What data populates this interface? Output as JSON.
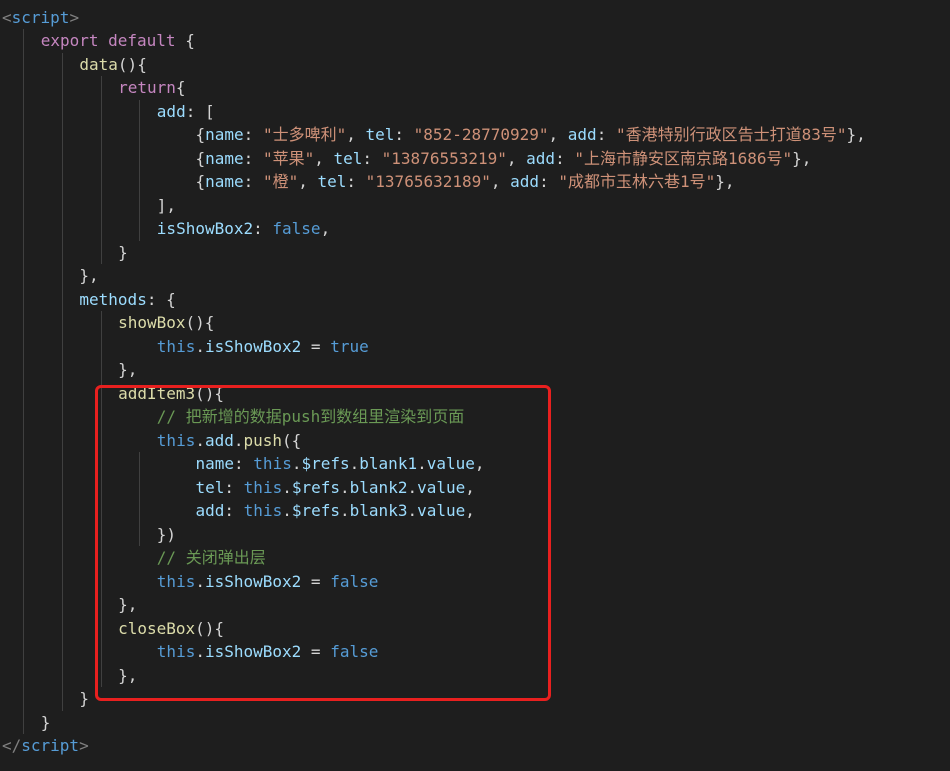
{
  "theme": {
    "background": "#1e1e1e",
    "highlight_box_color": "#e8201f"
  },
  "code_lines": [
    {
      "tokens": [
        {
          "c": "tag",
          "t": "<"
        },
        {
          "c": "tn",
          "t": "script"
        },
        {
          "c": "tag",
          "t": ">"
        }
      ]
    },
    {
      "tokens": [
        {
          "c": "kp",
          "t": "export"
        },
        {
          "c": "t",
          "t": " "
        },
        {
          "c": "kp",
          "t": "default"
        },
        {
          "c": "t",
          "t": " {"
        }
      ]
    },
    {
      "tokens": [
        {
          "c": "f",
          "t": "data"
        },
        {
          "c": "t",
          "t": "(){"
        }
      ]
    },
    {
      "tokens": [
        {
          "c": "kp",
          "t": "return"
        },
        {
          "c": "t",
          "t": "{"
        }
      ]
    },
    {
      "tokens": [
        {
          "c": "p",
          "t": "add"
        },
        {
          "c": "t",
          "t": ": ["
        }
      ]
    },
    {
      "tokens": [
        {
          "c": "t",
          "t": "{"
        },
        {
          "c": "p",
          "t": "name"
        },
        {
          "c": "t",
          "t": ": "
        },
        {
          "c": "s",
          "t": "\"士多啤利\""
        },
        {
          "c": "t",
          "t": ", "
        },
        {
          "c": "p",
          "t": "tel"
        },
        {
          "c": "t",
          "t": ": "
        },
        {
          "c": "s",
          "t": "\"852-28770929\""
        },
        {
          "c": "t",
          "t": ", "
        },
        {
          "c": "p",
          "t": "add"
        },
        {
          "c": "t",
          "t": ": "
        },
        {
          "c": "s",
          "t": "\"香港特别行政区告士打道83号\""
        },
        {
          "c": "t",
          "t": "},"
        }
      ]
    },
    {
      "tokens": [
        {
          "c": "t",
          "t": "{"
        },
        {
          "c": "p",
          "t": "name"
        },
        {
          "c": "t",
          "t": ": "
        },
        {
          "c": "s",
          "t": "\"苹果\""
        },
        {
          "c": "t",
          "t": ", "
        },
        {
          "c": "p",
          "t": "tel"
        },
        {
          "c": "t",
          "t": ": "
        },
        {
          "c": "s",
          "t": "\"13876553219\""
        },
        {
          "c": "t",
          "t": ", "
        },
        {
          "c": "p",
          "t": "add"
        },
        {
          "c": "t",
          "t": ": "
        },
        {
          "c": "s",
          "t": "\"上海市静安区南京路1686号\""
        },
        {
          "c": "t",
          "t": "},"
        }
      ]
    },
    {
      "tokens": [
        {
          "c": "t",
          "t": "{"
        },
        {
          "c": "p",
          "t": "name"
        },
        {
          "c": "t",
          "t": ": "
        },
        {
          "c": "s",
          "t": "\"橙\""
        },
        {
          "c": "t",
          "t": ", "
        },
        {
          "c": "p",
          "t": "tel"
        },
        {
          "c": "t",
          "t": ": "
        },
        {
          "c": "s",
          "t": "\"13765632189\""
        },
        {
          "c": "t",
          "t": ", "
        },
        {
          "c": "p",
          "t": "add"
        },
        {
          "c": "t",
          "t": ": "
        },
        {
          "c": "s",
          "t": "\"成都市玉林六巷1号\""
        },
        {
          "c": "t",
          "t": "},"
        }
      ]
    },
    {
      "tokens": [
        {
          "c": "t",
          "t": "],"
        }
      ]
    },
    {
      "tokens": [
        {
          "c": "p",
          "t": "isShowBox2"
        },
        {
          "c": "t",
          "t": ": "
        },
        {
          "c": "k",
          "t": "false"
        },
        {
          "c": "t",
          "t": ","
        }
      ]
    },
    {
      "tokens": [
        {
          "c": "t",
          "t": "}"
        }
      ]
    },
    {
      "tokens": [
        {
          "c": "t",
          "t": "},"
        }
      ]
    },
    {
      "tokens": [
        {
          "c": "p",
          "t": "methods"
        },
        {
          "c": "t",
          "t": ": {"
        }
      ]
    },
    {
      "tokens": [
        {
          "c": "f",
          "t": "showBox"
        },
        {
          "c": "t",
          "t": "(){"
        }
      ]
    },
    {
      "tokens": [
        {
          "c": "k",
          "t": "this"
        },
        {
          "c": "t",
          "t": "."
        },
        {
          "c": "p",
          "t": "isShowBox2"
        },
        {
          "c": "t",
          "t": " = "
        },
        {
          "c": "k",
          "t": "true"
        }
      ]
    },
    {
      "tokens": [
        {
          "c": "t",
          "t": "},"
        }
      ]
    },
    {
      "tokens": [
        {
          "c": "f",
          "t": "addItem3"
        },
        {
          "c": "t",
          "t": "(){"
        }
      ]
    },
    {
      "tokens": [
        {
          "c": "c",
          "t": "// 把新增的数据push到数组里渲染到页面"
        }
      ]
    },
    {
      "tokens": [
        {
          "c": "k",
          "t": "this"
        },
        {
          "c": "t",
          "t": "."
        },
        {
          "c": "p",
          "t": "add"
        },
        {
          "c": "t",
          "t": "."
        },
        {
          "c": "f",
          "t": "push"
        },
        {
          "c": "t",
          "t": "({"
        }
      ]
    },
    {
      "tokens": [
        {
          "c": "p",
          "t": "name"
        },
        {
          "c": "t",
          "t": ": "
        },
        {
          "c": "k",
          "t": "this"
        },
        {
          "c": "t",
          "t": "."
        },
        {
          "c": "p",
          "t": "$refs"
        },
        {
          "c": "t",
          "t": "."
        },
        {
          "c": "p",
          "t": "blank1"
        },
        {
          "c": "t",
          "t": "."
        },
        {
          "c": "p",
          "t": "value"
        },
        {
          "c": "t",
          "t": ","
        }
      ]
    },
    {
      "tokens": [
        {
          "c": "p",
          "t": "tel"
        },
        {
          "c": "t",
          "t": ": "
        },
        {
          "c": "k",
          "t": "this"
        },
        {
          "c": "t",
          "t": "."
        },
        {
          "c": "p",
          "t": "$refs"
        },
        {
          "c": "t",
          "t": "."
        },
        {
          "c": "p",
          "t": "blank2"
        },
        {
          "c": "t",
          "t": "."
        },
        {
          "c": "p",
          "t": "value"
        },
        {
          "c": "t",
          "t": ","
        }
      ]
    },
    {
      "tokens": [
        {
          "c": "p",
          "t": "add"
        },
        {
          "c": "t",
          "t": ": "
        },
        {
          "c": "k",
          "t": "this"
        },
        {
          "c": "t",
          "t": "."
        },
        {
          "c": "p",
          "t": "$refs"
        },
        {
          "c": "t",
          "t": "."
        },
        {
          "c": "p",
          "t": "blank3"
        },
        {
          "c": "t",
          "t": "."
        },
        {
          "c": "p",
          "t": "value"
        },
        {
          "c": "t",
          "t": ","
        }
      ]
    },
    {
      "tokens": [
        {
          "c": "t",
          "t": "})"
        }
      ]
    },
    {
      "tokens": [
        {
          "c": "c",
          "t": "// 关闭弹出层"
        }
      ]
    },
    {
      "tokens": [
        {
          "c": "k",
          "t": "this"
        },
        {
          "c": "t",
          "t": "."
        },
        {
          "c": "p",
          "t": "isShowBox2"
        },
        {
          "c": "t",
          "t": " = "
        },
        {
          "c": "k",
          "t": "false"
        }
      ]
    },
    {
      "tokens": [
        {
          "c": "t",
          "t": "},"
        }
      ]
    },
    {
      "tokens": [
        {
          "c": "f",
          "t": "closeBox"
        },
        {
          "c": "t",
          "t": "(){"
        }
      ]
    },
    {
      "tokens": [
        {
          "c": "k",
          "t": "this"
        },
        {
          "c": "t",
          "t": "."
        },
        {
          "c": "p",
          "t": "isShowBox2"
        },
        {
          "c": "t",
          "t": " = "
        },
        {
          "c": "k",
          "t": "false"
        }
      ]
    },
    {
      "tokens": [
        {
          "c": "t",
          "t": "},"
        }
      ]
    },
    {
      "tokens": [
        {
          "c": "t",
          "t": "}"
        }
      ]
    },
    {
      "tokens": [
        {
          "c": "t",
          "t": "}"
        }
      ]
    },
    {
      "tokens": [
        {
          "c": "tag",
          "t": "</"
        },
        {
          "c": "tn",
          "t": "script"
        },
        {
          "c": "tag",
          "t": ">"
        }
      ]
    }
  ]
}
